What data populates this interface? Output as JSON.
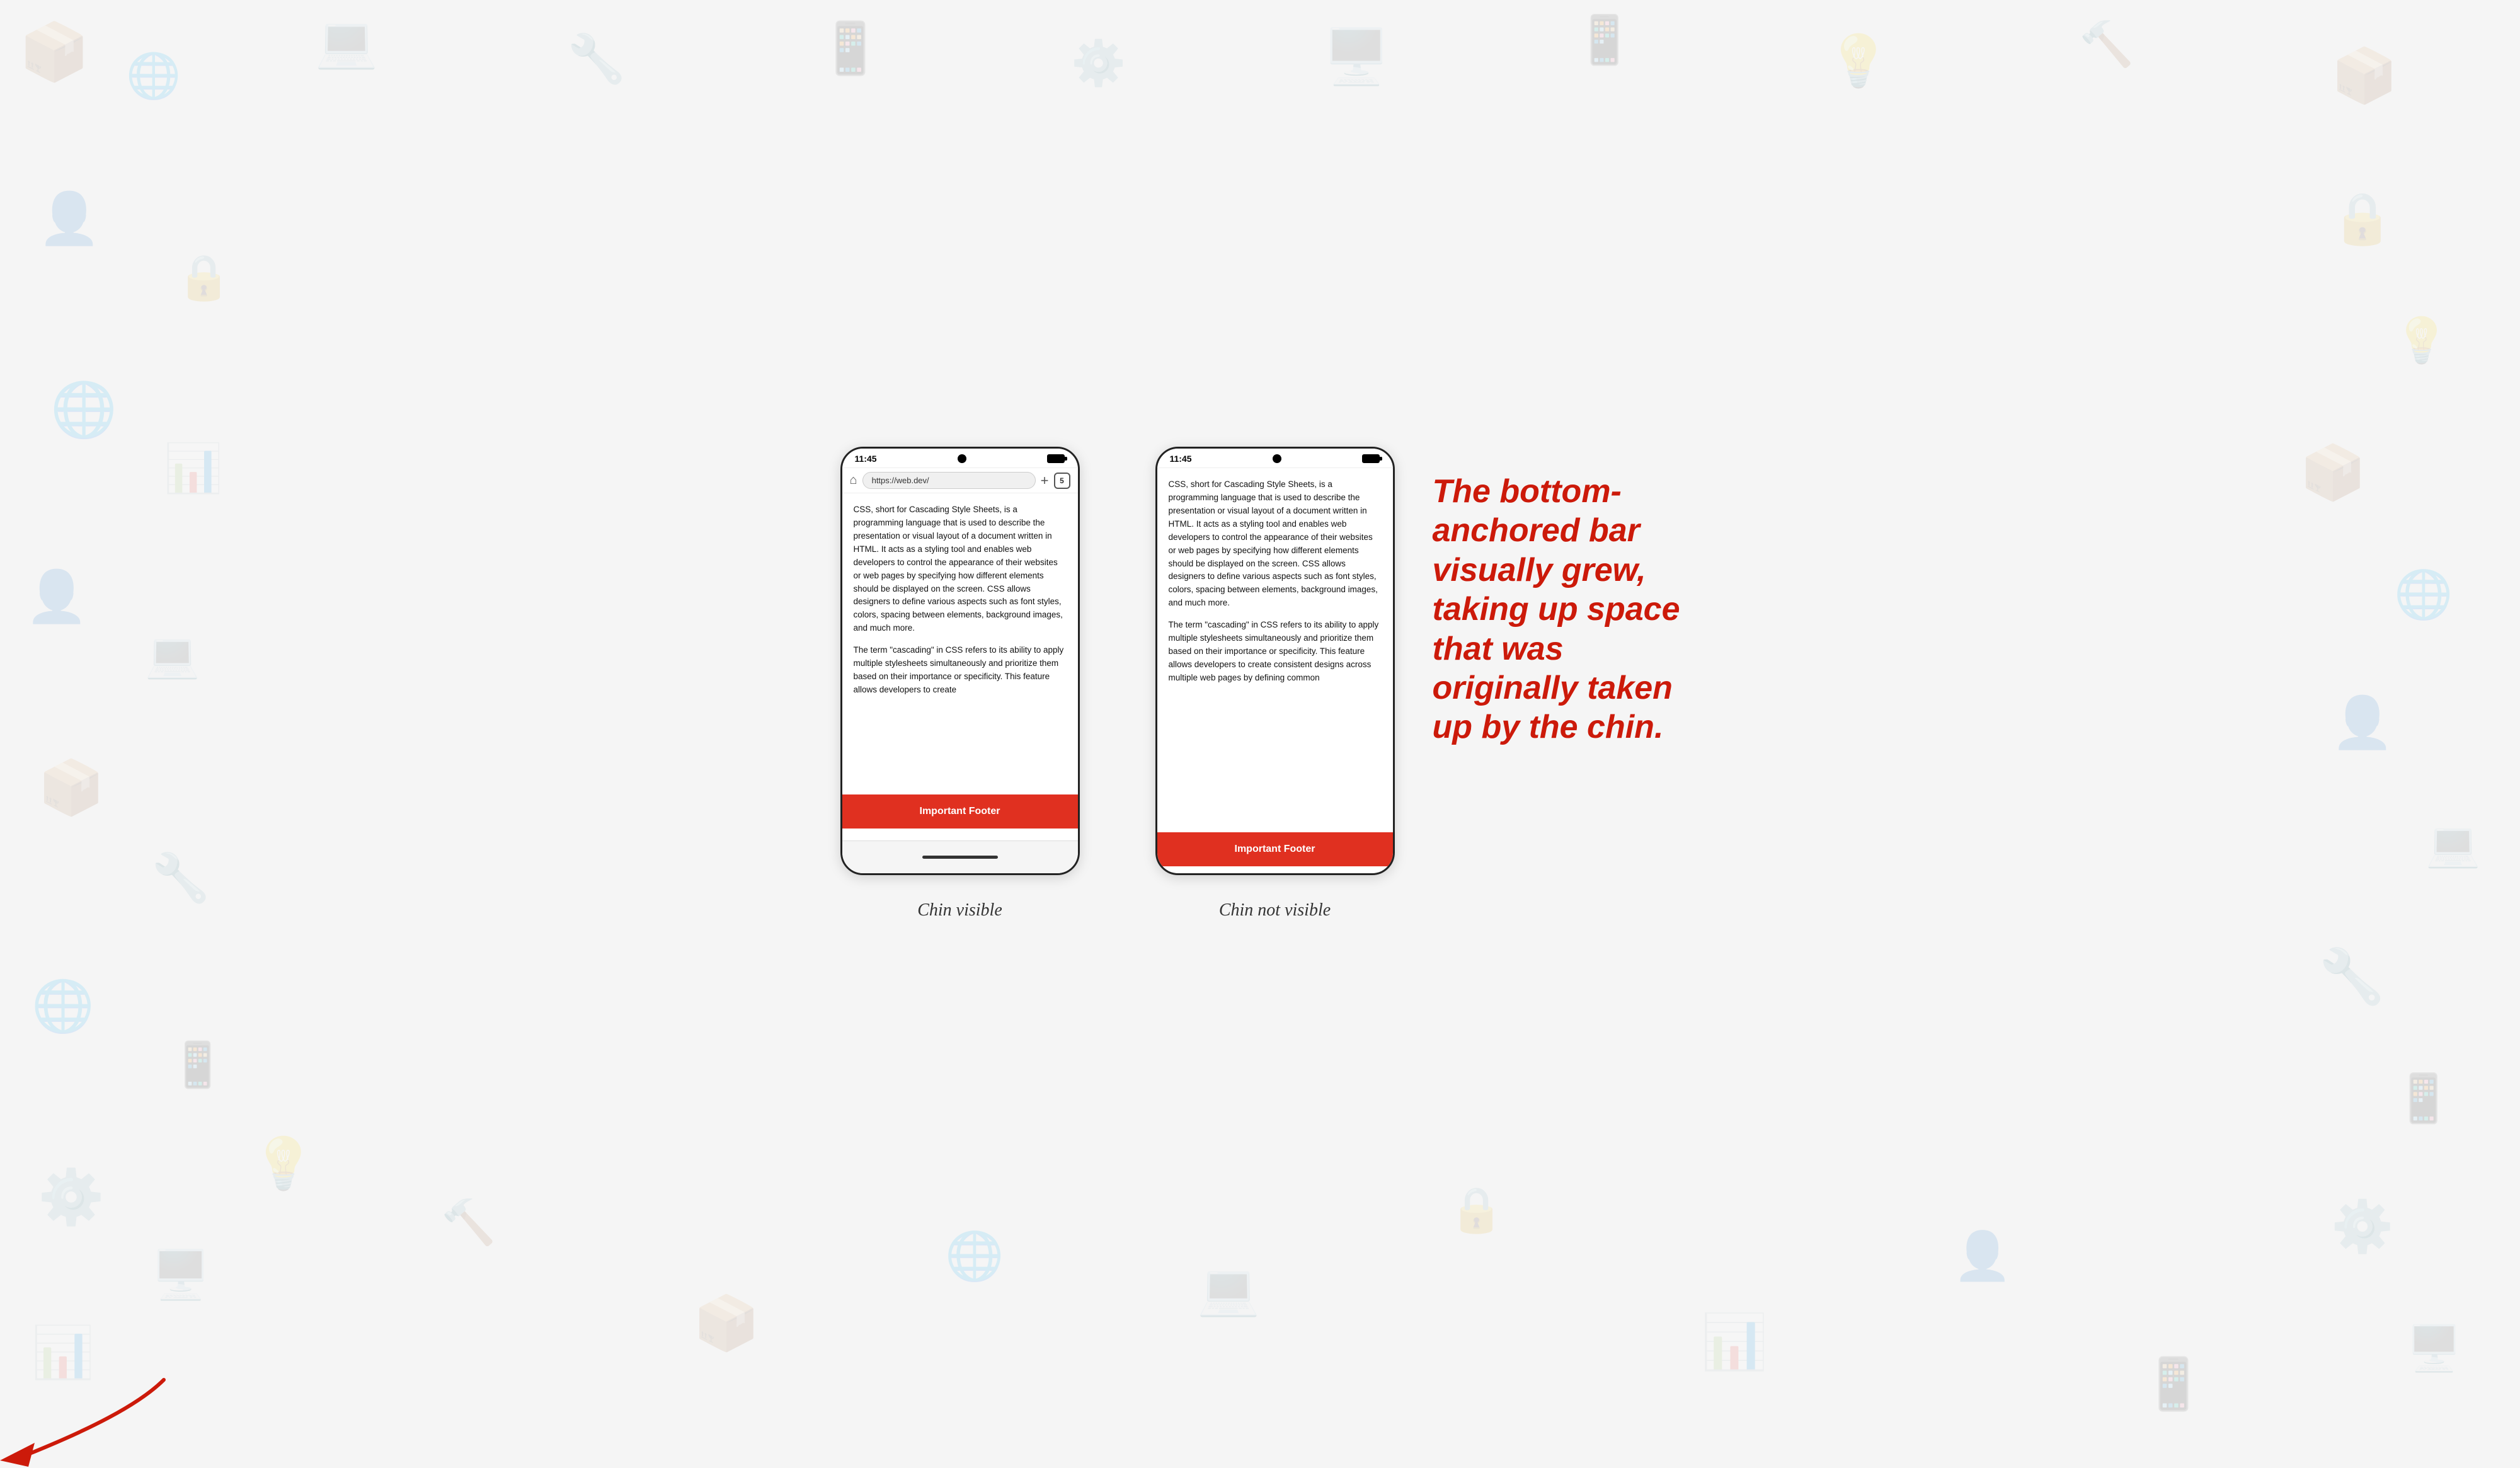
{
  "phones": {
    "left": {
      "status_time": "11:45",
      "caption": "Chin visible",
      "url": "https://web.dev/",
      "tabs_count": "5",
      "content_paragraph1": "CSS, short for Cascading Style Sheets, is a programming language that is used to describe the presentation or visual layout of a document written in HTML. It acts as a styling tool and enables web developers to control the appearance of their websites or web pages by specifying how different elements should be displayed on the screen. CSS allows designers to define various aspects such as font styles, colors, spacing between elements, background images, and much more.",
      "content_paragraph2": "The term \"cascading\" in CSS refers to its ability to apply multiple stylesheets simultaneously and prioritize them based on their importance or specificity. This feature allows developers to create",
      "footer_label": "Important Footer"
    },
    "right": {
      "status_time": "11:45",
      "caption": "Chin not visible",
      "content_paragraph1": "CSS, short for Cascading Style Sheets, is a programming language that is used to describe the presentation or visual layout of a document written in HTML. It acts as a styling tool and enables web developers to control the appearance of their websites or web pages by specifying how different elements should be displayed on the screen. CSS allows designers to define various aspects such as font styles, colors, spacing between elements, background images, and much more.",
      "content_paragraph2": "The term \"cascading\" in CSS refers to its ability to apply multiple stylesheets simultaneously and prioritize them based on their importance or specificity. This feature allows developers to create consistent designs across multiple web pages by defining common",
      "footer_label": "Important Footer"
    }
  },
  "annotation": {
    "line1": "The bottom-",
    "line2": "anchored bar",
    "line3": "visually grew,",
    "line4": "taking up space",
    "line5": "that was",
    "line6": "originally taken",
    "line7": "up by the chin."
  }
}
